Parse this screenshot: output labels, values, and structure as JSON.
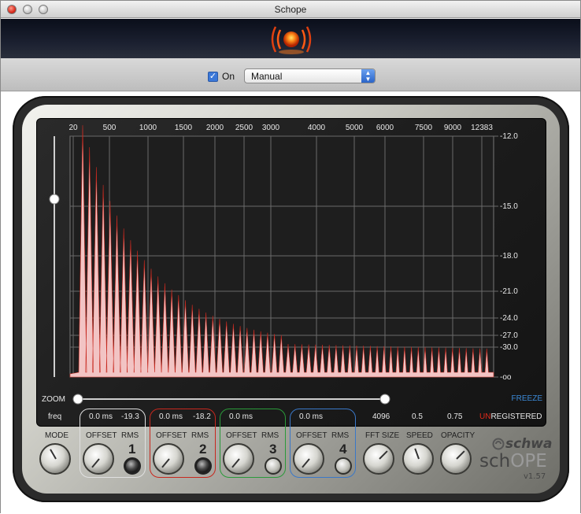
{
  "window": {
    "title": "Schope"
  },
  "controls": {
    "on_label": "On",
    "on_checked": "✓",
    "mode_value": "Manual"
  },
  "scope": {
    "freq_ticks": [
      "20",
      "500",
      "1000",
      "1500",
      "2000",
      "2500",
      "3000",
      "4000",
      "5000",
      "6000",
      "7500",
      "9000",
      "12383"
    ],
    "db_ticks": [
      "-12.0",
      "-15.0",
      "-18.0",
      "-21.0",
      "-24.0",
      "-27.0",
      "-30.0",
      "-oo"
    ],
    "zoom_label": "ZOOM",
    "freeze_label": "FREEZE"
  },
  "readouts": {
    "freq": "freq",
    "ch1_offset": "0.0 ms",
    "ch1_rms": "-19.3",
    "ch2_offset": "0.0 ms",
    "ch2_rms": "-18.2",
    "ch3_offset": "0.0 ms",
    "ch4_offset": "0.0 ms",
    "fft_size": "4096",
    "speed": "0.5",
    "opacity": "0.75",
    "registered_un": "UN",
    "registered_rest": "REGISTERED"
  },
  "knob_labels": {
    "mode": "MODE",
    "offset": "OFFSET",
    "rms": "RMS",
    "fft_size": "FFT SIZE",
    "speed": "SPEED",
    "opacity": "OPACITY"
  },
  "channels": [
    "1",
    "2",
    "3",
    "4"
  ],
  "branding": {
    "company": "schwa",
    "product_a": "sch",
    "product_b": "OPE",
    "version": "v1.57"
  },
  "colors": {
    "ch1": "#e8e8e8",
    "ch2": "#c8281e",
    "ch3": "#2a9a3a",
    "ch4": "#3a78c8",
    "spectrum_fill": "#f2c4c4",
    "peak": "#c8281e"
  }
}
